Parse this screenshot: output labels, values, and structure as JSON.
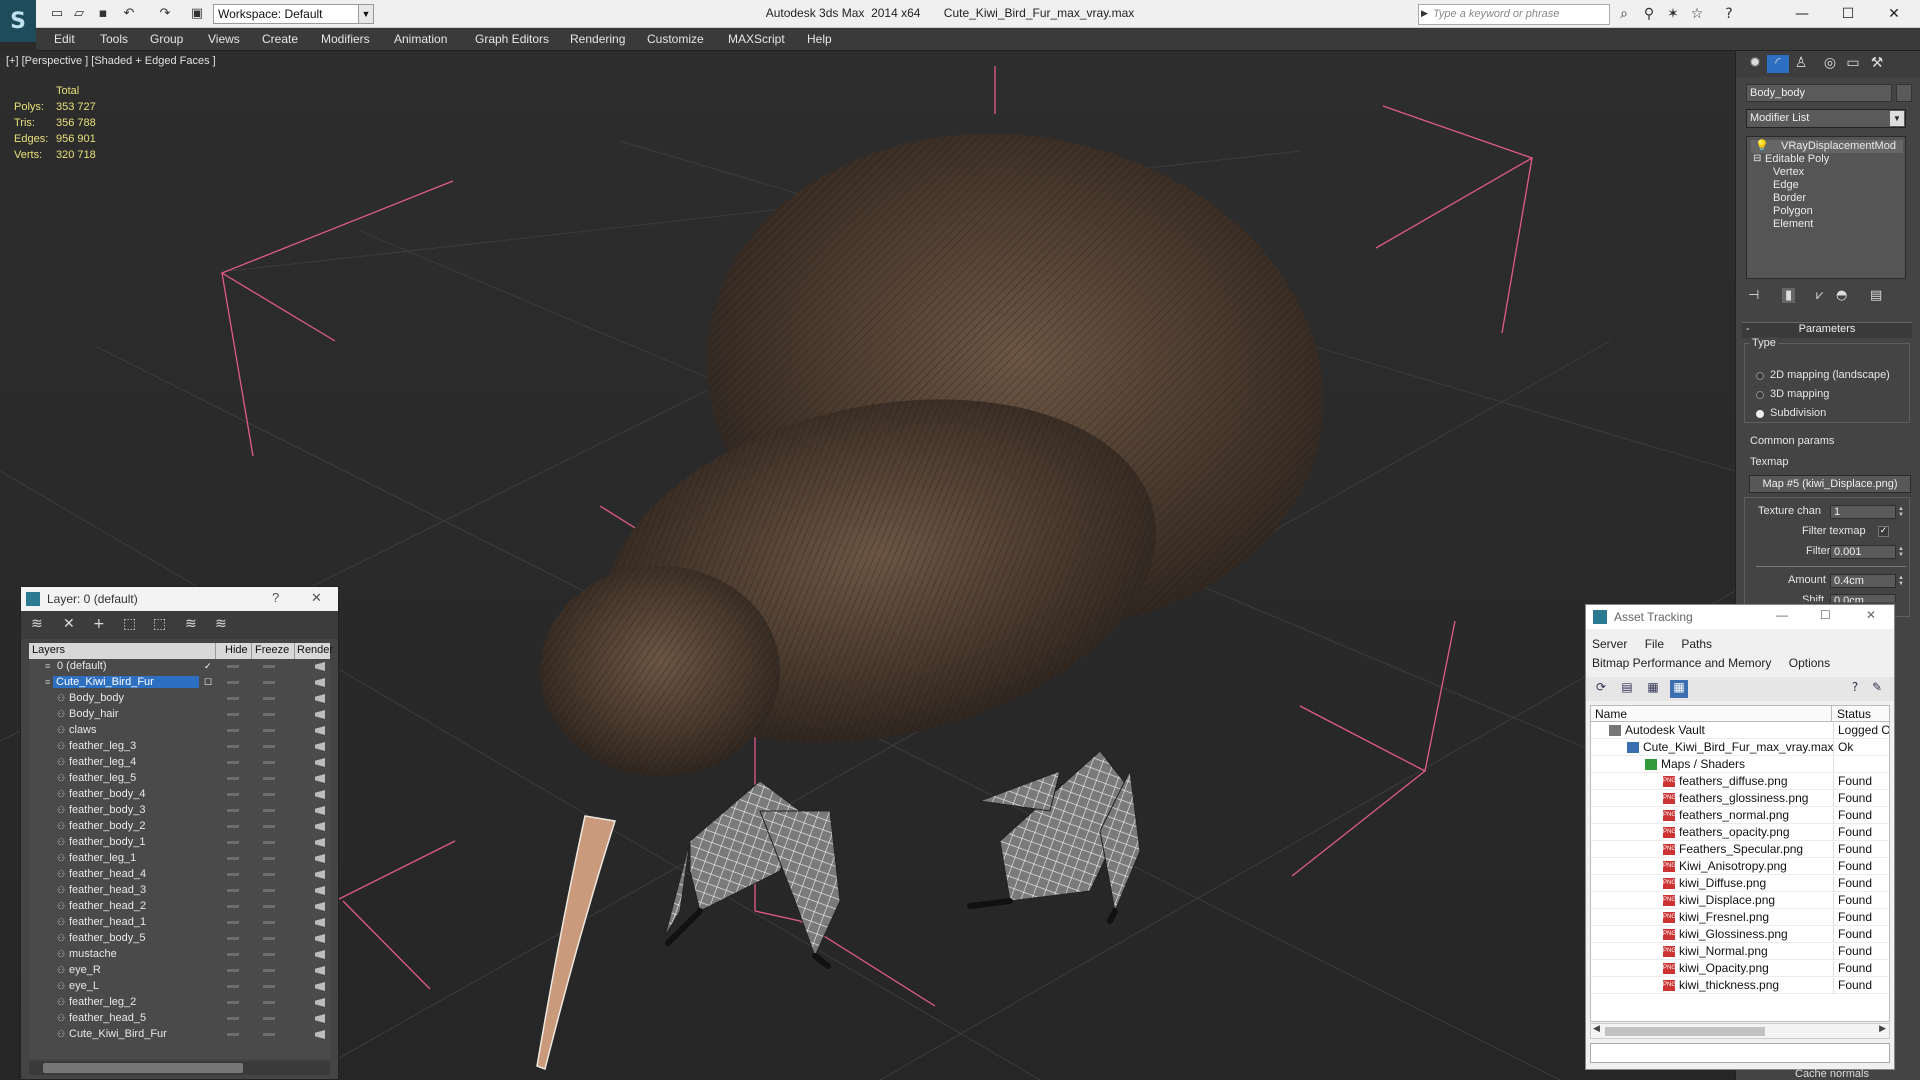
{
  "titlebar": {
    "workspace": "Workspace: Default",
    "app_title": "Autodesk 3ds Max  2014 x64       Cute_Kiwi_Bird_Fur_max_vray.max",
    "search_placeholder": "Type a keyword or phrase"
  },
  "menu": [
    "Edit",
    "Tools",
    "Group",
    "Views",
    "Create",
    "Modifiers",
    "Animation",
    "Graph Editors",
    "Rendering",
    "Customize",
    "MAXScript",
    "Help"
  ],
  "viewport": {
    "label": "[+] [Perspective ] [Shaded + Edged Faces ]",
    "stats": {
      "header": "Total",
      "rows": [
        {
          "k": "Polys:",
          "v": "353 727"
        },
        {
          "k": "Tris:",
          "v": "356 788"
        },
        {
          "k": "Edges:",
          "v": "956 901"
        },
        {
          "k": "Verts:",
          "v": "320 718"
        }
      ]
    }
  },
  "layer_window": {
    "title": "Layer: 0 (default)",
    "help": "?",
    "columns": [
      "Layers",
      "Hide",
      "Freeze",
      "Render"
    ],
    "rows": [
      {
        "name": "0 (default)",
        "indent": 1,
        "checked": true
      },
      {
        "name": "Cute_Kiwi_Bird_Fur",
        "indent": 1,
        "selected": true
      },
      {
        "name": "Body_body",
        "indent": 2
      },
      {
        "name": "Body_hair",
        "indent": 2
      },
      {
        "name": "claws",
        "indent": 2
      },
      {
        "name": "feather_leg_3",
        "indent": 2
      },
      {
        "name": "feather_leg_4",
        "indent": 2
      },
      {
        "name": "feather_leg_5",
        "indent": 2
      },
      {
        "name": "feather_body_4",
        "indent": 2
      },
      {
        "name": "feather_body_3",
        "indent": 2
      },
      {
        "name": "feather_body_2",
        "indent": 2
      },
      {
        "name": "feather_body_1",
        "indent": 2
      },
      {
        "name": "feather_leg_1",
        "indent": 2
      },
      {
        "name": "feather_head_4",
        "indent": 2
      },
      {
        "name": "feather_head_3",
        "indent": 2
      },
      {
        "name": "feather_head_2",
        "indent": 2
      },
      {
        "name": "feather_head_1",
        "indent": 2
      },
      {
        "name": "feather_body_5",
        "indent": 2
      },
      {
        "name": "mustache",
        "indent": 2
      },
      {
        "name": "eye_R",
        "indent": 2
      },
      {
        "name": "eye_L",
        "indent": 2
      },
      {
        "name": "feather_leg_2",
        "indent": 2
      },
      {
        "name": "feather_head_5",
        "indent": 2
      },
      {
        "name": "Cute_Kiwi_Bird_Fur",
        "indent": 2
      }
    ]
  },
  "command_panel": {
    "object_name": "Body_body",
    "modifier_list": "Modifier List",
    "stack": [
      {
        "label": "VRayDisplacementMod",
        "level": 0,
        "bulb": true
      },
      {
        "label": "Editable Poly",
        "level": 0,
        "minus": true
      },
      {
        "label": "Vertex",
        "level": 1
      },
      {
        "label": "Edge",
        "level": 1
      },
      {
        "label": "Border",
        "level": 1
      },
      {
        "label": "Polygon",
        "level": 1
      },
      {
        "label": "Element",
        "level": 1
      }
    ],
    "params": {
      "header": "Parameters",
      "type_label": "Type",
      "options": [
        "2D mapping (landscape)",
        "3D mapping",
        "Subdivision"
      ],
      "selected_option": 2,
      "common_params": "Common params",
      "texmap_label": "Texmap",
      "texmap_value": "Map #5 (kiwi_Displace.png)",
      "texture_chan_label": "Texture chan",
      "texture_chan_value": "1",
      "filter_texmap_label": "Filter texmap",
      "filter_texmap_checked": true,
      "filter_blur_label": "Filter blur",
      "filter_blur_value": "0.001",
      "amount_label": "Amount",
      "amount_value": "0.4cm",
      "shift_label": "Shift",
      "shift_value": "0.0cm",
      "cache_normals": "Cache normals"
    }
  },
  "asset_tracking": {
    "title": "Asset Tracking",
    "menu_row1": [
      "Server",
      "File",
      "Paths"
    ],
    "menu_row2": [
      "Bitmap Performance and Memory",
      "Options"
    ],
    "columns": [
      "Name",
      "Status"
    ],
    "rows": [
      {
        "name": "Autodesk Vault",
        "status": "Logged O",
        "level": 0,
        "icon": "vault"
      },
      {
        "name": "Cute_Kiwi_Bird_Fur_max_vray.max",
        "status": "Ok",
        "level": 1,
        "icon": "max"
      },
      {
        "name": "Maps / Shaders",
        "status": "",
        "level": 2,
        "icon": "folder"
      },
      {
        "name": "feathers_diffuse.png",
        "status": "Found",
        "level": 3,
        "icon": "png"
      },
      {
        "name": "feathers_glossiness.png",
        "status": "Found",
        "level": 3,
        "icon": "png"
      },
      {
        "name": "feathers_normal.png",
        "status": "Found",
        "level": 3,
        "icon": "png"
      },
      {
        "name": "feathers_opacity.png",
        "status": "Found",
        "level": 3,
        "icon": "png"
      },
      {
        "name": "Feathers_Specular.png",
        "status": "Found",
        "level": 3,
        "icon": "png"
      },
      {
        "name": "Kiwi_Anisotropy.png",
        "status": "Found",
        "level": 3,
        "icon": "png"
      },
      {
        "name": "kiwi_Diffuse.png",
        "status": "Found",
        "level": 3,
        "icon": "png"
      },
      {
        "name": "kiwi_Displace.png",
        "status": "Found",
        "level": 3,
        "icon": "png"
      },
      {
        "name": "kiwi_Fresnel.png",
        "status": "Found",
        "level": 3,
        "icon": "png"
      },
      {
        "name": "kiwi_Glossiness.png",
        "status": "Found",
        "level": 3,
        "icon": "png"
      },
      {
        "name": "kiwi_Normal.png",
        "status": "Found",
        "level": 3,
        "icon": "png"
      },
      {
        "name": "kiwi_Opacity.png",
        "status": "Found",
        "level": 3,
        "icon": "png"
      },
      {
        "name": "kiwi_thickness.png",
        "status": "Found",
        "level": 3,
        "icon": "png"
      }
    ]
  },
  "colors": {
    "selection_blue": "#2d6fc0",
    "stats_yellow": "#e6e07a",
    "bbox_pink": "#e05a8a"
  }
}
